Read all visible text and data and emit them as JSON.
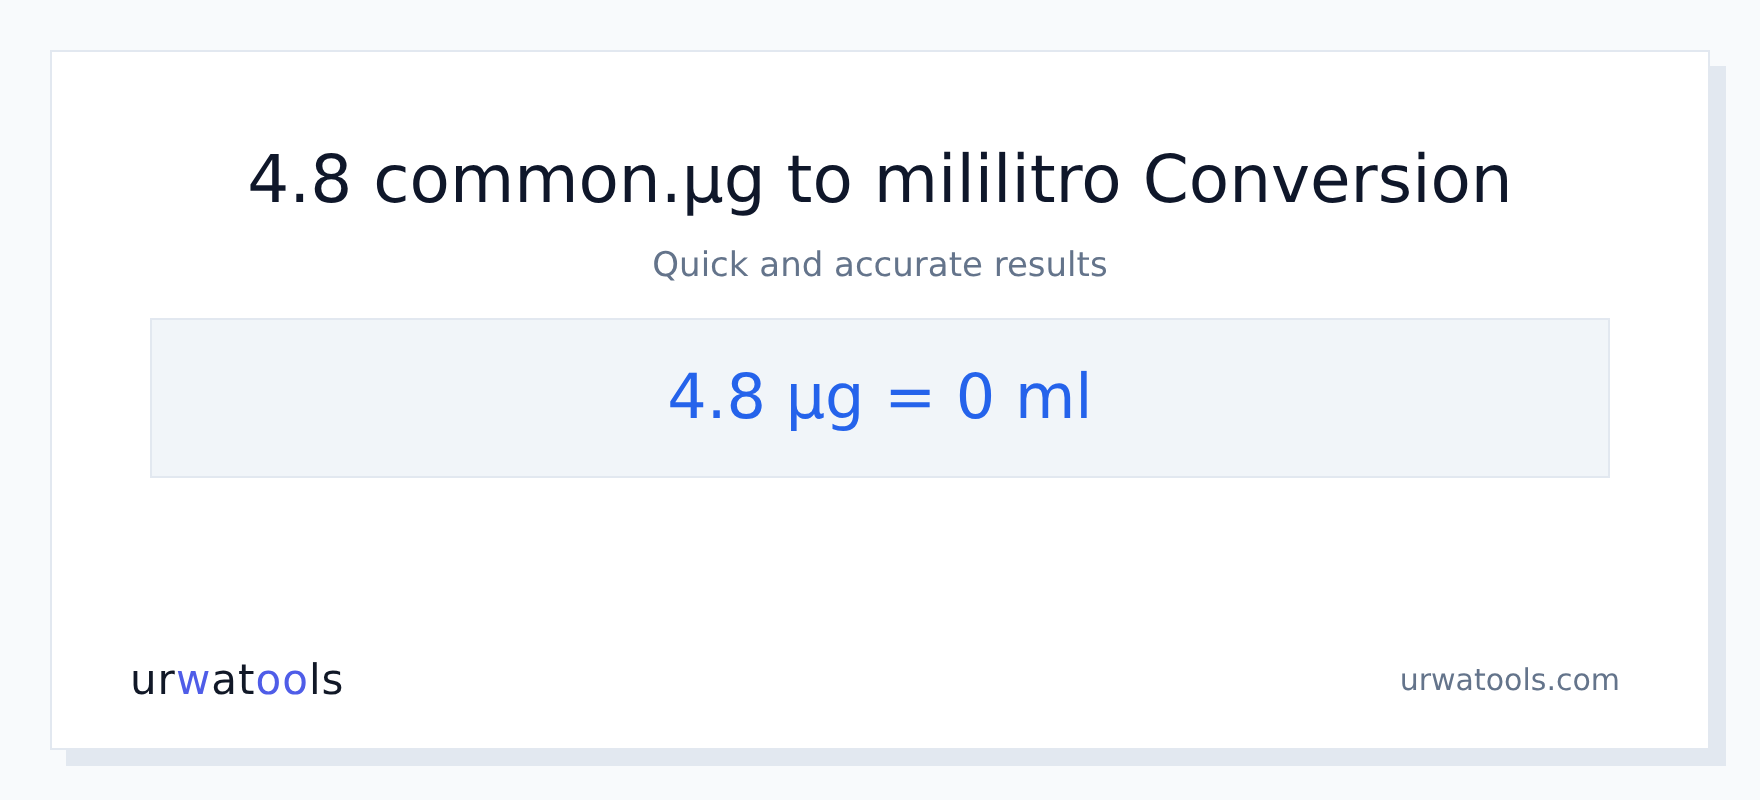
{
  "title": "4.8 common.µg to mililitro Conversion",
  "subtitle": "Quick and accurate results",
  "result": "4.8 µg = 0 ml",
  "logo": [
    {
      "text": "ur",
      "accent": false
    },
    {
      "text": "w",
      "accent": true
    },
    {
      "text": "at",
      "accent": false
    },
    {
      "text": "oo",
      "accent": true
    },
    {
      "text": "ls",
      "accent": false
    }
  ],
  "site": "urwatools.com"
}
